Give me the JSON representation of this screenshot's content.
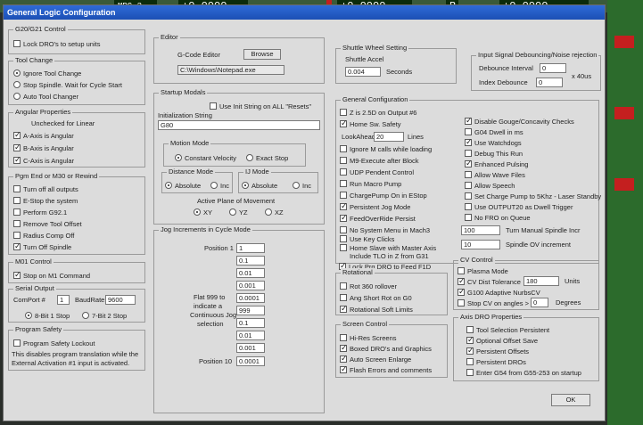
{
  "background": {
    "readouts": [
      "MPG 3",
      "+0.0000",
      "+0.0000",
      "+0.0000"
    ],
    "button_letter": "B"
  },
  "dialog": {
    "title": "General Logic Configuration"
  },
  "g20": {
    "title": "G20/G21 Control",
    "lock_dros": "Lock DRO's to setup units"
  },
  "tool_change": {
    "title": "Tool Change",
    "ignore": "Ignore Tool Change",
    "stop_spindle": "Stop Spindle. Wait for Cycle Start",
    "auto": "Auto Tool Changer"
  },
  "angular": {
    "title": "Angular Properties",
    "note": "Unchecked for Linear",
    "a_axis": "A-Axis is Angular",
    "b_axis": "B-Axis is Angular",
    "c_axis": "C-Axis is Angular"
  },
  "pgm_end": {
    "title": "Pgm End or M30 or Rewind",
    "turn_off_outputs": "Turn off all outputs",
    "estop": "E-Stop the system",
    "perform_g92": "Perform G92.1",
    "remove_offset": "Remove Tool Offset",
    "radius_comp": "Radius Comp Off",
    "turn_off_spindle": "Turn Off Spindle"
  },
  "m01": {
    "title": "M01 Control",
    "stop_on_m1": "Stop on M1 Command"
  },
  "serial": {
    "title": "Serial Output",
    "com_port_label": "ComPort #",
    "com_port_value": "1",
    "baud_label": "BaudRate",
    "baud_value": "9600",
    "bit8": "8-Bit 1 Stop",
    "bit7": "7-Bit 2 Stop"
  },
  "program_safety": {
    "title": "Program Safety",
    "lockout": "Program Safety Lockout",
    "note_1": "This disables program translation while the",
    "note_2": "External Activation #1 input is activated."
  },
  "editor": {
    "title": "Editor",
    "gcode_label": "G-Code Editor",
    "browse": "Browse",
    "path": "C:\\Windows\\Notepad.exe"
  },
  "startup": {
    "title": "Startup Modals",
    "use_init": "Use Init String on ALL \"Resets\"",
    "init_label": "Initialization String",
    "init_value": "G80"
  },
  "motion_mode": {
    "title": "Motion Mode",
    "constant": "Constant Velocity",
    "exact": "Exact Stop"
  },
  "distance_mode": {
    "title": "Distance Mode",
    "absolute": "Absolute",
    "inc": "Inc"
  },
  "ij_mode": {
    "title": "IJ Mode",
    "absolute": "Absolute",
    "inc": "Inc"
  },
  "plane": {
    "title": "Active Plane of Movement",
    "xy": "XY",
    "yz": "YZ",
    "xz": "XZ"
  },
  "jog": {
    "title": "Jog Increments in Cycle Mode",
    "position_1": "Position 1",
    "flat_note_1": "Flat 999 to",
    "flat_note_2": "indicate a",
    "flat_note_3": "Continuous Jog",
    "flat_note_4": "selection",
    "position_10": "Position 10",
    "values": [
      "1",
      "0.1",
      "0.01",
      "0.001",
      "0.0001",
      "999",
      "0.1",
      "0.01",
      "0.001",
      "0.0001"
    ]
  },
  "shuttle": {
    "title": "Shuttle Wheel Setting",
    "accel_label": "Shuttle Accel",
    "accel_value": "0.004",
    "seconds": "Seconds"
  },
  "debounce": {
    "title": "Input Signal Debouncing/Noise rejection",
    "interval_label": "Debounce Interval",
    "interval_value": "0",
    "index_label": "Index Debounce",
    "index_value": "0",
    "unit": "x 40us"
  },
  "general": {
    "title": "General Configuration",
    "z_2_5d": "Z is 2.5D on Output #6",
    "home_safety": "Home Sw. Safety",
    "lookahead_label": "LookAhead",
    "lookahead_value": "20",
    "lines": "Lines",
    "ignore_m": "Ignore M calls while loading",
    "m9_execute": "M9-Execute after Block",
    "udp_pendent": "UDP Pendent Control",
    "run_macro_pump": "Run Macro Pump",
    "charge_pump": "ChargePump On in EStop",
    "persistent_jog": "Persistent Jog Mode",
    "feed_override": "FeedOverRide Persist",
    "no_system_menu": "No System Menu in Mach3",
    "use_key_clicks": "Use Key Clicks",
    "home_slave": "Home Slave with Master Axis",
    "include_tlo": "Include TLO in Z from G31",
    "lock_prg": "Lock Prg DRO to Feed F1D",
    "disable_gouge": "Disable Gouge/Concavity Checks",
    "g04_dwell": "G04 Dwell in ms",
    "use_watchdogs": "Use Watchdogs",
    "debug": "Debug This Run",
    "enhanced_pulsing": "Enhanced Pulsing",
    "allow_wave": "Allow Wave Files",
    "allow_speech": "Allow Speech",
    "set_charge_pump": "Set Charge Pump to 5Khz - Laser Standby",
    "use_output20": "Use OUTPUT20 as Dwell Trigger",
    "no_fro": "No FRO on Queue",
    "turn_manual_value": "100",
    "turn_manual_label": "Turn Manual Spindle Incr",
    "spindle_ov_value": "10",
    "spindle_ov_label": "Spindle OV increment"
  },
  "rotational": {
    "title": "Rotational",
    "rot_360": "Rot 360 rollover",
    "ang_short": "Ang Short Rot on G0",
    "rot_soft": "Rotational Soft Limits"
  },
  "cv_control": {
    "title": "CV Control",
    "plasma": "Plasma Mode",
    "cv_dist": "CV Dist Tolerance",
    "cv_dist_value": "180",
    "units": "Units",
    "g100": "G100 Adaptive NurbsCV",
    "stop_cv": "Stop CV on angles >",
    "stop_cv_value": "0",
    "degrees": "Degrees"
  },
  "screen_control": {
    "title": "Screen Control",
    "hi_res": "Hi-Res Screens",
    "boxed_dros": "Boxed DRO's and Graphics",
    "auto_enlarge": "Auto Screen Enlarge",
    "flash_errors": "Flash Errors and comments"
  },
  "axis_dro": {
    "title": "Axis DRO Properties",
    "tool_selection": "Tool Selection Persistent",
    "optional_offset": "Optional Offset Save",
    "persistent_offsets": "Persistent Offsets",
    "persistent_dros": "Persistent DROs",
    "enter_g54": "Enter G54 from G55-253 on startup"
  },
  "ok_button": "OK"
}
